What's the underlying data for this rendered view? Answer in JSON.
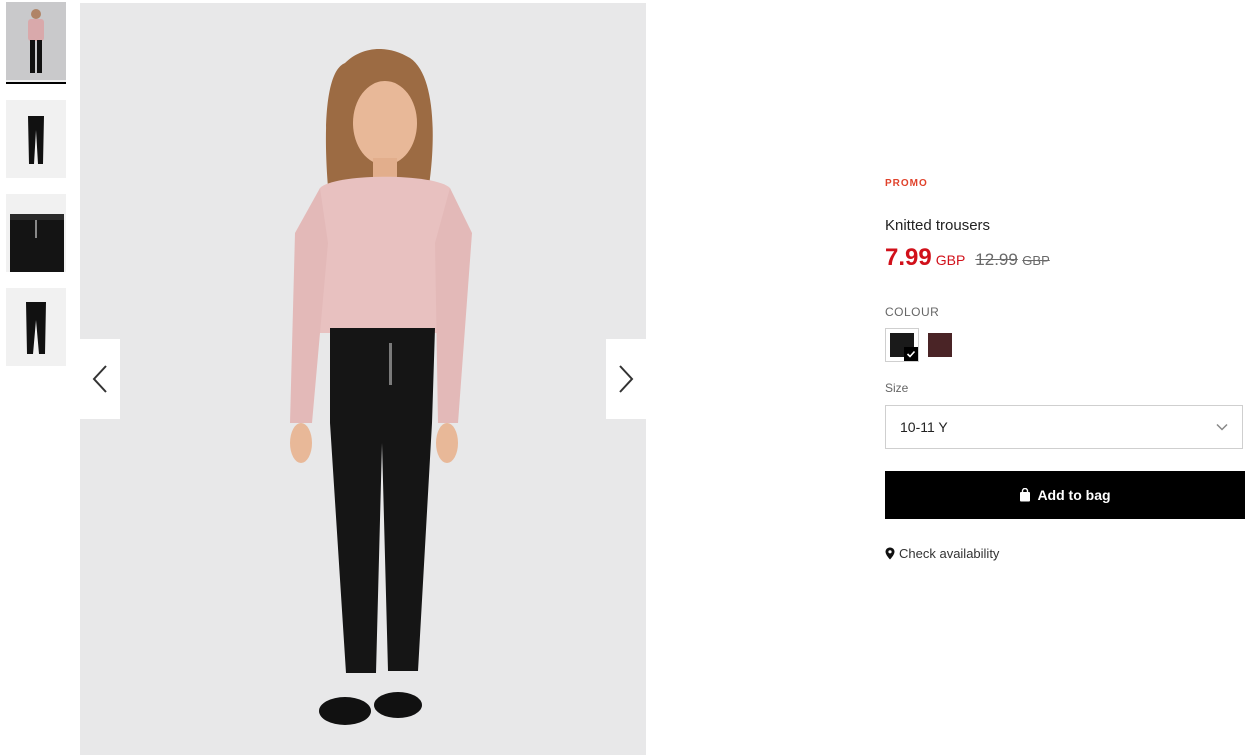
{
  "gallery": {
    "thumbnails": [
      "model-front",
      "trousers-front",
      "trousers-detail",
      "trousers-back"
    ],
    "active_index": 0
  },
  "product": {
    "badge": "PROMO",
    "name": "Knitted trousers",
    "price_current": "7.99",
    "price_current_currency": "GBP",
    "price_old": "12.99",
    "price_old_currency": "GBP",
    "colour_label": "COLOUR",
    "colours": [
      {
        "name": "black",
        "hex": "#1a1a1a",
        "selected": true
      },
      {
        "name": "dark-burgundy",
        "hex": "#4a2426",
        "selected": false
      }
    ],
    "size_label": "Size",
    "size_selected": "10-11 Y",
    "add_to_bag_label": "Add to bag",
    "check_availability_label": "Check availability"
  },
  "colors": {
    "promo": "#e0422b",
    "price": "#d1101a",
    "button_bg": "#000000"
  }
}
